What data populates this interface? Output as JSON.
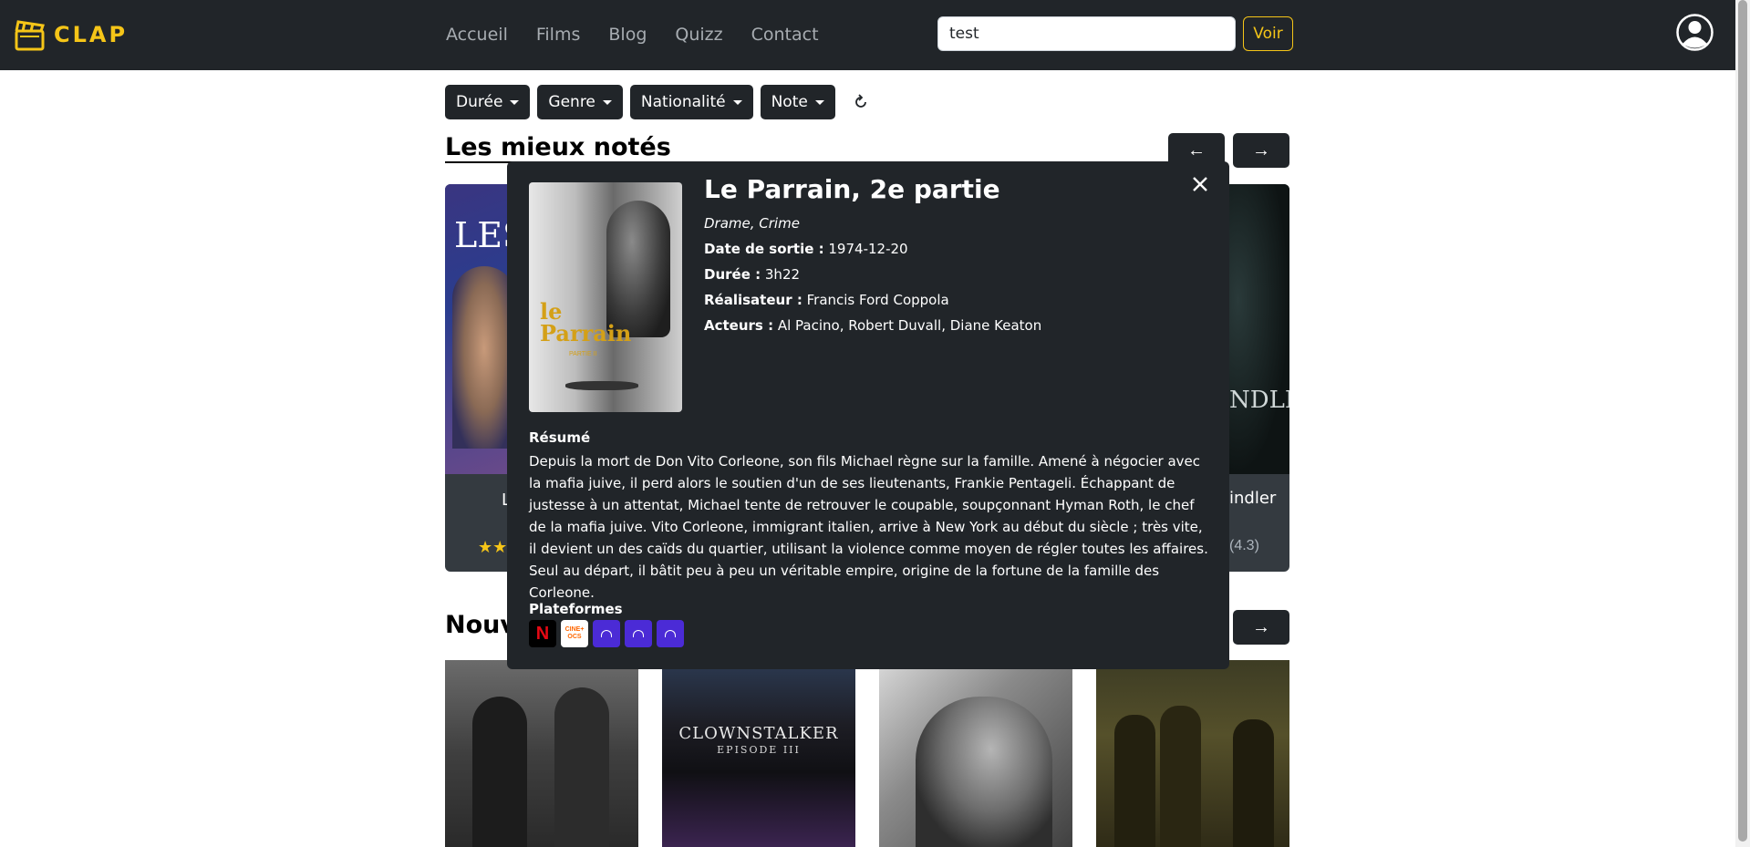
{
  "navbar": {
    "logo_text": "CLAP",
    "links": [
      "Accueil",
      "Films",
      "Blog",
      "Quizz",
      "Contact"
    ],
    "search_value": "test",
    "voir_label": "Voir"
  },
  "filters": [
    "Durée",
    "Genre",
    "Nationalité",
    "Note"
  ],
  "sections": {
    "top_rated_title": "Les mieux notés",
    "new_title": "Nouv"
  },
  "cards_row1": {
    "left_poster_text": "LES",
    "left_caption": "L",
    "right_poster_text": "NDLER",
    "right_caption": "indler",
    "right_rating": "(4.3)"
  },
  "row2": {
    "clownstalker_title": "CLOWNSTALKER",
    "clownstalker_sub": "EPISODE III"
  },
  "modal": {
    "title": "Le Parrain, 2e partie",
    "genres": "Drame, Crime",
    "release_label": "Date de sortie :",
    "release_value": "1974-12-20",
    "duration_label": "Durée :",
    "duration_value": "3h22",
    "director_label": "Réalisateur :",
    "director_value": "Francis Ford Coppola",
    "actors_label": "Acteurs :",
    "actors_value": "Al Pacino, Robert Duvall, Diane Keaton",
    "resume_label": "Résumé",
    "resume": "Depuis la mort de Don Vito Corleone, son fils Michael règne sur la famille. Amené à négocier avec la mafia juive, il perd alors le soutien d'un de ses lieutenants, Frankie Pentageli. Échappant de justesse à un attentat, Michael tente de retrouver le coupable, soupçonnant Hyman Roth, le chef de la mafia juive. Vito Corleone, immigrant italien, arrive à New York au début du siècle ; très vite, il devient un des caïds du quartier, utilisant la violence comme moyen de régler toutes les affaires. Seul au départ, il bâtit peu à peu un véritable empire, origine de la fortune de la famille des Corleone.",
    "platforms_label": "Plateformes",
    "poster_text": "le Parrain",
    "poster_sub": "PARTIE II",
    "platforms": [
      {
        "name": "netflix-icon",
        "label": "N",
        "bg": "#000000",
        "color": "#e50914"
      },
      {
        "name": "cine-ocs-icon",
        "label": "CINE+ OCS",
        "bg": "#ffffff",
        "color": "#ff6600"
      },
      {
        "name": "paramount-icon",
        "label": "",
        "bg": "#4b2bd6",
        "color": "#ffffff"
      },
      {
        "name": "paramount-plus-icon",
        "label": "",
        "bg": "#4b2bd6",
        "color": "#ffffff"
      },
      {
        "name": "paramount-channel-icon",
        "label": "",
        "bg": "#4b2bd6",
        "color": "#ffffff"
      }
    ]
  },
  "colors": {
    "accent": "#f5c518",
    "dark": "#212529"
  }
}
